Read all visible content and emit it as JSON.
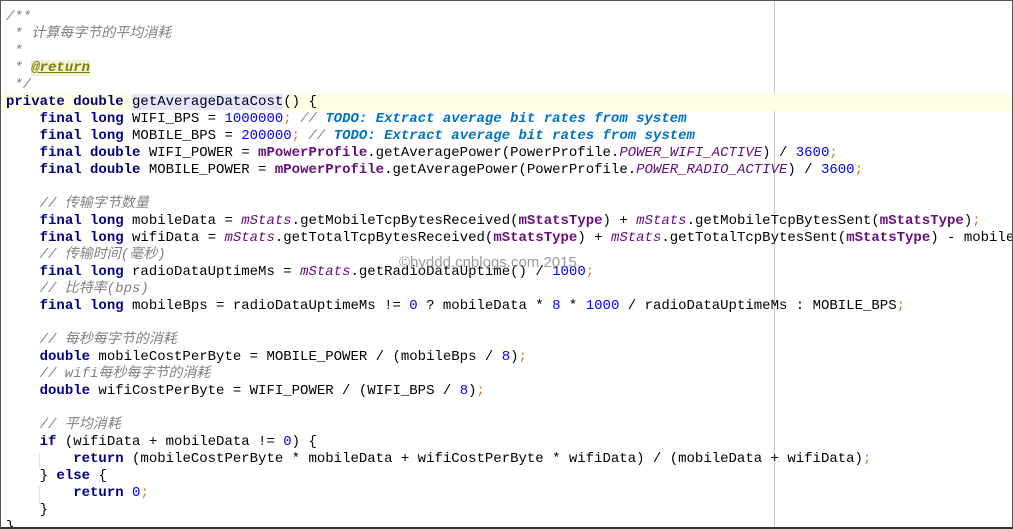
{
  "watermark": "©hyddd.cnblogs.com 2015",
  "colors": {
    "keyword": "#000080",
    "number": "#0000ff",
    "comment": "#808080",
    "todo": "#0073bf",
    "field": "#660e7a",
    "current_line": "#ffffe4",
    "identifier_highlight": "#e4e4ff"
  },
  "editor": {
    "current_line": 5,
    "lines": [
      [
        [
          "c",
          "/**"
        ]
      ],
      [
        [
          "c",
          " * 计算每字节的平均消耗"
        ]
      ],
      [
        [
          "c",
          " *"
        ]
      ],
      [
        [
          "c",
          " * "
        ],
        [
          "d",
          "@return"
        ]
      ],
      [
        [
          "c",
          " */"
        ]
      ],
      [
        [
          "k",
          "private double "
        ],
        [
          "h",
          "getAverageDataCost"
        ],
        [
          "t",
          "() {"
        ]
      ],
      [
        [
          "t",
          "    "
        ],
        [
          "k",
          "final long "
        ],
        [
          "t",
          "WIFI_BPS = "
        ],
        [
          "n",
          "1000000"
        ],
        [
          "p",
          ";"
        ],
        [
          "c",
          " // "
        ],
        [
          "o",
          "TODO: Extract average bit rates from system"
        ]
      ],
      [
        [
          "t",
          "    "
        ],
        [
          "k",
          "final long "
        ],
        [
          "t",
          "MOBILE_BPS = "
        ],
        [
          "n",
          "200000"
        ],
        [
          "p",
          ";"
        ],
        [
          "c",
          " // "
        ],
        [
          "o",
          "TODO: Extract average bit rates from system"
        ]
      ],
      [
        [
          "t",
          "    "
        ],
        [
          "k",
          "final double "
        ],
        [
          "t",
          "WIFI_POWER = "
        ],
        [
          "f",
          "mPowerProfile"
        ],
        [
          "t",
          ".getAveragePower(PowerProfile."
        ],
        [
          "s",
          "POWER_WIFI_ACTIVE"
        ],
        [
          "t",
          ") / "
        ],
        [
          "n",
          "3600"
        ],
        [
          "p",
          ";"
        ]
      ],
      [
        [
          "t",
          "    "
        ],
        [
          "k",
          "final double "
        ],
        [
          "t",
          "MOBILE_POWER = "
        ],
        [
          "f",
          "mPowerProfile"
        ],
        [
          "t",
          ".getAveragePower(PowerProfile."
        ],
        [
          "s",
          "POWER_RADIO_ACTIVE"
        ],
        [
          "t",
          ") / "
        ],
        [
          "n",
          "3600"
        ],
        [
          "p",
          ";"
        ]
      ],
      [
        [
          "t",
          ""
        ]
      ],
      [
        [
          "c",
          "    // 传输字节数量"
        ]
      ],
      [
        [
          "t",
          "    "
        ],
        [
          "k",
          "final long "
        ],
        [
          "t",
          "mobileData = "
        ],
        [
          "s",
          "mStats"
        ],
        [
          "t",
          ".getMobileTcpBytesReceived("
        ],
        [
          "f",
          "mStatsType"
        ],
        [
          "t",
          ") + "
        ],
        [
          "s",
          "mStats"
        ],
        [
          "t",
          ".getMobileTcpBytesSent("
        ],
        [
          "f",
          "mStatsType"
        ],
        [
          "t",
          ")"
        ],
        [
          "p",
          ";"
        ]
      ],
      [
        [
          "t",
          "    "
        ],
        [
          "k",
          "final long "
        ],
        [
          "t",
          "wifiData = "
        ],
        [
          "s",
          "mStats"
        ],
        [
          "t",
          ".getTotalTcpBytesReceived("
        ],
        [
          "f",
          "mStatsType"
        ],
        [
          "t",
          ") + "
        ],
        [
          "s",
          "mStats"
        ],
        [
          "t",
          ".getTotalTcpBytesSent("
        ],
        [
          "f",
          "mStatsType"
        ],
        [
          "t",
          ") - mobileData"
        ],
        [
          "p",
          ";"
        ]
      ],
      [
        [
          "c",
          "    // 传输时间(毫秒)"
        ]
      ],
      [
        [
          "t",
          "    "
        ],
        [
          "k",
          "final long "
        ],
        [
          "t",
          "radioDataUptimeMs = "
        ],
        [
          "s",
          "mStats"
        ],
        [
          "t",
          ".getRadioDataUptime() / "
        ],
        [
          "n",
          "1000"
        ],
        [
          "p",
          ";"
        ]
      ],
      [
        [
          "c",
          "    // 比特率(bps)"
        ]
      ],
      [
        [
          "t",
          "    "
        ],
        [
          "k",
          "final long "
        ],
        [
          "t",
          "mobileBps = radioDataUptimeMs != "
        ],
        [
          "n",
          "0"
        ],
        [
          "t",
          " ? mobileData * "
        ],
        [
          "n",
          "8"
        ],
        [
          "t",
          " * "
        ],
        [
          "n",
          "1000"
        ],
        [
          "t",
          " / radioDataUptimeMs : MOBILE_BPS"
        ],
        [
          "p",
          ";"
        ]
      ],
      [
        [
          "t",
          ""
        ]
      ],
      [
        [
          "c",
          "    // 每秒每字节的消耗"
        ]
      ],
      [
        [
          "t",
          "    "
        ],
        [
          "k",
          "double "
        ],
        [
          "t",
          "mobileCostPerByte = MOBILE_POWER / (mobileBps / "
        ],
        [
          "n",
          "8"
        ],
        [
          "t",
          ")"
        ],
        [
          "p",
          ";"
        ]
      ],
      [
        [
          "c",
          "    // wifi每秒每字节的消耗"
        ]
      ],
      [
        [
          "t",
          "    "
        ],
        [
          "k",
          "double "
        ],
        [
          "t",
          "wifiCostPerByte = WIFI_POWER / (WIFI_BPS / "
        ],
        [
          "n",
          "8"
        ],
        [
          "t",
          ")"
        ],
        [
          "p",
          ";"
        ]
      ],
      [
        [
          "t",
          ""
        ]
      ],
      [
        [
          "c",
          "    // 平均消耗"
        ]
      ],
      [
        [
          "t",
          "    "
        ],
        [
          "k",
          "if "
        ],
        [
          "t",
          "(wifiData + mobileData != "
        ],
        [
          "n",
          "0"
        ],
        [
          "t",
          ") {"
        ]
      ],
      [
        [
          "t",
          "        "
        ],
        [
          "k",
          "return "
        ],
        [
          "t",
          "(mobileCostPerByte * mobileData + wifiCostPerByte * wifiData) / (mobileData + wifiData)"
        ],
        [
          "p",
          ";"
        ]
      ],
      [
        [
          "t",
          "    } "
        ],
        [
          "k",
          "else "
        ],
        [
          "t",
          "{"
        ]
      ],
      [
        [
          "t",
          "        "
        ],
        [
          "k",
          "return "
        ],
        [
          "n",
          "0"
        ],
        [
          "p",
          ";"
        ]
      ],
      [
        [
          "t",
          "    }"
        ]
      ],
      [
        [
          "t",
          "}"
        ]
      ]
    ]
  }
}
